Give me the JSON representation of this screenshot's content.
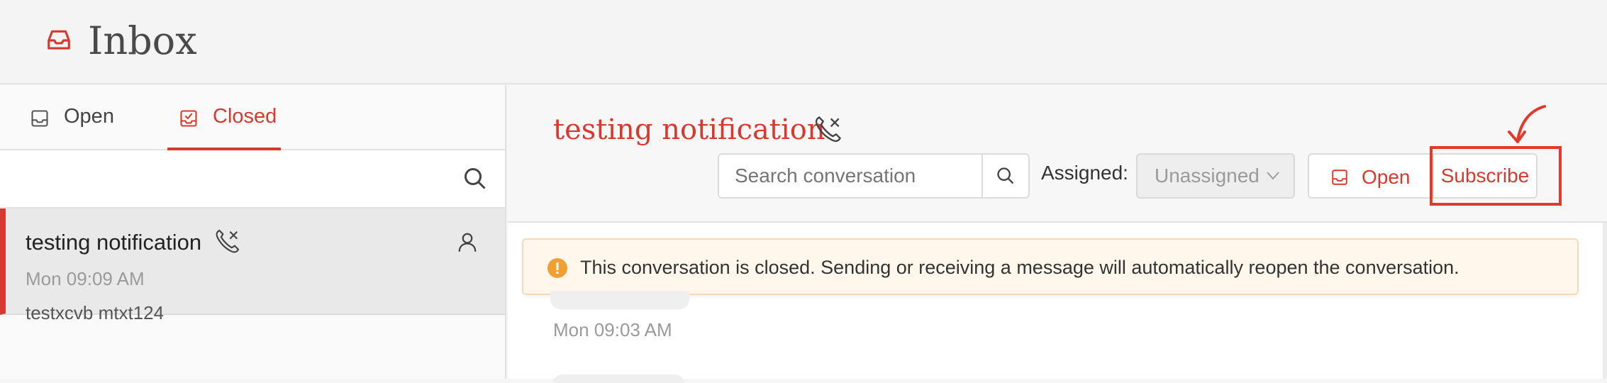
{
  "header": {
    "title": "Inbox",
    "icon": "inbox-icon"
  },
  "tabs": [
    {
      "label": "Open",
      "icon": "inbox-tray-icon"
    },
    {
      "label": "Closed",
      "icon": "checked-tray-icon",
      "active": true
    }
  ],
  "conversation_list": [
    {
      "title": "testing notification",
      "time": "Mon 09:09 AM",
      "preview": "testxcvb mtxt124",
      "selected": true
    }
  ],
  "conversation": {
    "title": "testing notification",
    "search_placeholder": "Search conversation",
    "assigned_label": "Assigned:",
    "assigned_value": "Unassigned",
    "open_label": "Open",
    "subscribe_label": "Subscribe",
    "banner_text": "This conversation is closed. Sending or receiving a message will automatically reopen the conversation.",
    "message_time": "Mon 09:03 AM"
  },
  "colors": {
    "accent": "#d63a2f",
    "annotation": "#e23a2a",
    "warning": "#f0a030"
  }
}
